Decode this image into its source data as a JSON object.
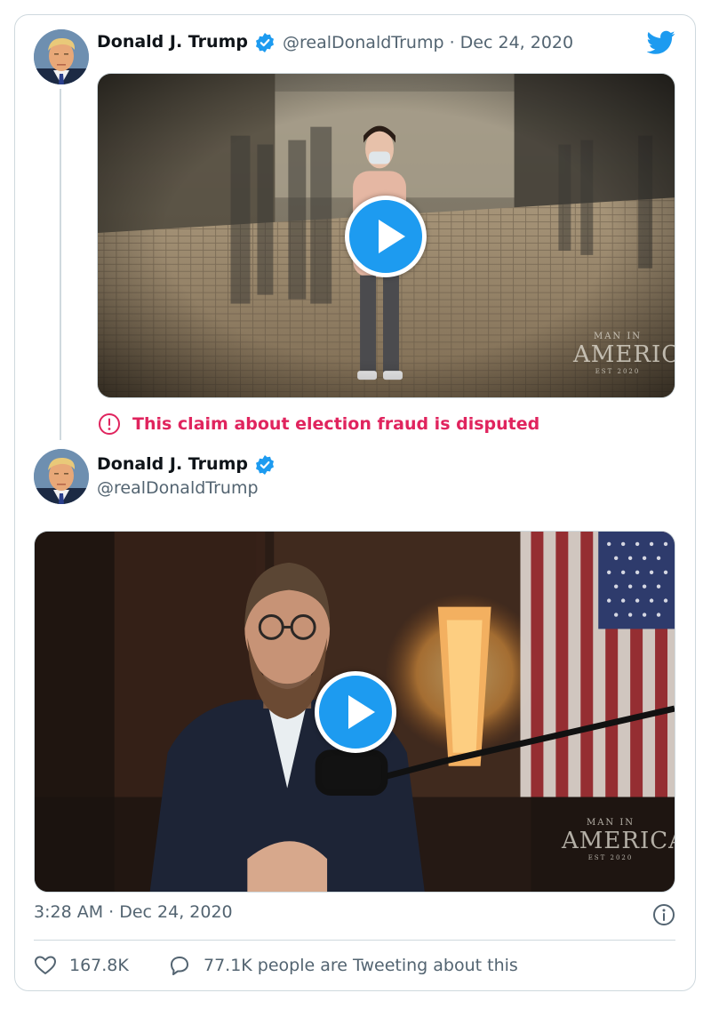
{
  "brand": {
    "icon": "twitter-bird-icon",
    "color": "#1d9bf0"
  },
  "tweets": [
    {
      "author": {
        "name": "Donald J. Trump",
        "handle": "@realDonaldTrump",
        "verified": true
      },
      "separator": "·",
      "date": "Dec 24, 2020",
      "media": {
        "type": "video",
        "watermark": {
          "top": "MAN IN",
          "main": "AMERICA",
          "bottom": "EST 2020"
        }
      },
      "notice": {
        "icon": "exclamation-circle-icon",
        "text": "This claim about election fraud is disputed",
        "color": "#e0245e"
      }
    },
    {
      "author": {
        "name": "Donald J. Trump",
        "handle": "@realDonaldTrump",
        "verified": true
      },
      "media": {
        "type": "video",
        "watermark": {
          "top": "MAN IN",
          "main": "AMERICA",
          "bottom": "EST 2020"
        }
      }
    }
  ],
  "footer": {
    "timestamp": "3:28 AM · Dec 24, 2020",
    "likes": "167.8K",
    "conversation": "77.1K people are Tweeting about this"
  },
  "colors": {
    "verified": "#1d9bf0",
    "muted": "#536471",
    "border": "#cfd9de"
  }
}
